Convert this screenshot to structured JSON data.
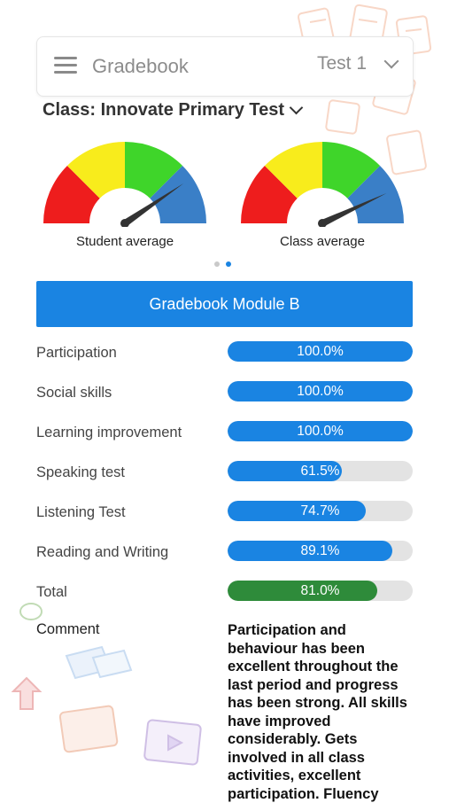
{
  "header": {
    "app_title": "Gradebook",
    "test_selected": "Test 1"
  },
  "class_select": {
    "label": "Class: Innovate Primary Test"
  },
  "gauges": [
    {
      "label": "Student average",
      "value_pct": 81.0
    },
    {
      "label": "Class average",
      "value_pct": 86.0
    }
  ],
  "pager": {
    "pages": 2,
    "active": 1
  },
  "module": {
    "title": "Gradebook Module B"
  },
  "scores": [
    {
      "label": "Participation",
      "value_text": "100.0%",
      "value": 100.0
    },
    {
      "label": "Social skills",
      "value_text": "100.0%",
      "value": 100.0
    },
    {
      "label": "Learning improvement",
      "value_text": "100.0%",
      "value": 100.0
    },
    {
      "label": "Speaking test",
      "value_text": "61.5%",
      "value": 61.5
    },
    {
      "label": "Listening Test",
      "value_text": "74.7%",
      "value": 74.7
    },
    {
      "label": "Reading and Writing",
      "value_text": "89.1%",
      "value": 89.1
    },
    {
      "label": "Total",
      "value_text": "81.0%",
      "value": 81.0,
      "total": true
    }
  ],
  "comment": {
    "label": "Comment",
    "text": "Participation and behaviour has been excellent throughout the last period and progress has been strong. All skills have improved considerably. Gets involved in all class activities, excellent participation. Fluency"
  },
  "colors": {
    "primary": "#1a84e2",
    "total": "#2e8b3a",
    "gauge_red": "#ee1d1d",
    "gauge_yellow": "#f8ec1c",
    "gauge_green": "#3fd52a",
    "gauge_blue": "#3a7fc7"
  },
  "icons": [
    "menu-icon",
    "chevron-down-icon"
  ]
}
